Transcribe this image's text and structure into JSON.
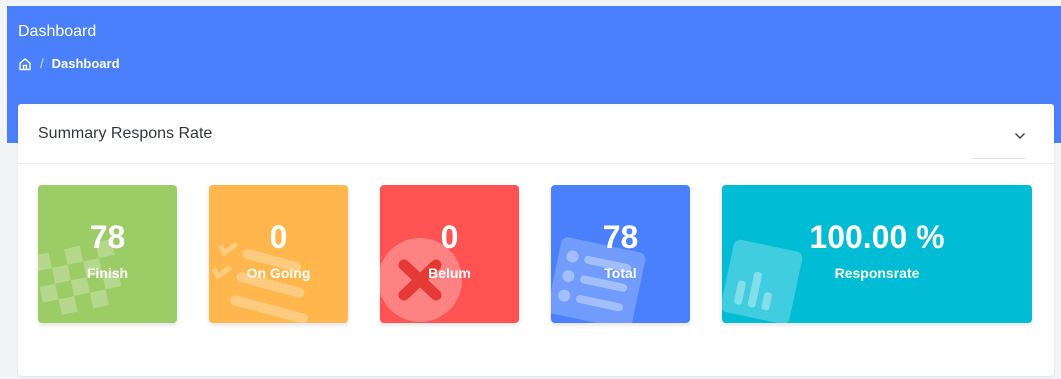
{
  "header": {
    "title": "Dashboard",
    "breadcrumb": {
      "current": "Dashboard"
    }
  },
  "card": {
    "title": "Summary Respons Rate"
  },
  "tiles": [
    {
      "value": "78",
      "label": "Finish",
      "color": "#9ccc65",
      "icon": "flag-checkered-icon"
    },
    {
      "value": "0",
      "label": "On Going",
      "color": "#ffb74d",
      "icon": "list-check-icon"
    },
    {
      "value": "0",
      "label": "Belum",
      "color": "#ff5252",
      "icon": "times-circle-icon"
    },
    {
      "value": "78",
      "label": "Total",
      "color": "#4a80fb",
      "icon": "list-alt-icon"
    },
    {
      "value": "100.00 %",
      "label": "Responsrate",
      "color": "#00bcd4",
      "icon": "chart-bar-icon"
    }
  ],
  "colors": {
    "header_band": "#4a80fb",
    "page_background": "#f3f4f7"
  }
}
